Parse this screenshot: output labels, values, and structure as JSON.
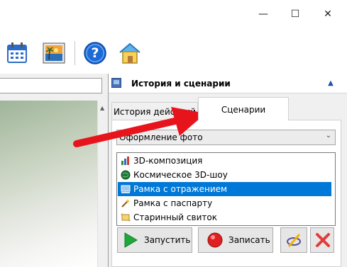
{
  "titlebar": {
    "minimize_glyph": "—",
    "maximize_glyph": "☐",
    "close_glyph": "✕"
  },
  "toolbar": {
    "icons": [
      "calendar-icon",
      "photo-icon",
      "help-icon",
      "home-icon"
    ],
    "help_glyph": "?"
  },
  "panel": {
    "title": "История и сценарии",
    "pin_glyph": "▲"
  },
  "tabs": [
    {
      "label": "История действий",
      "active": false
    },
    {
      "label": "Сценарии",
      "active": true
    }
  ],
  "scenario": {
    "category_selected": "Оформление фото",
    "dropdown_glyph": "⌄",
    "items": [
      {
        "label": "3D-композиция",
        "icon": "chart-3d-icon"
      },
      {
        "label": "Космическое 3D-шоу",
        "icon": "globe-icon"
      },
      {
        "label": "Рамка с отражением",
        "icon": "frame-reflection-icon",
        "selected": true
      },
      {
        "label": "Рамка с паспарту",
        "icon": "wand-icon"
      },
      {
        "label": "Старинный свиток",
        "icon": "scroll-icon"
      }
    ]
  },
  "buttons": {
    "run_label": "Запустить",
    "record_label": "Записать"
  },
  "colors": {
    "selection": "#0078d7",
    "annotation_arrow": "#e8141b"
  }
}
